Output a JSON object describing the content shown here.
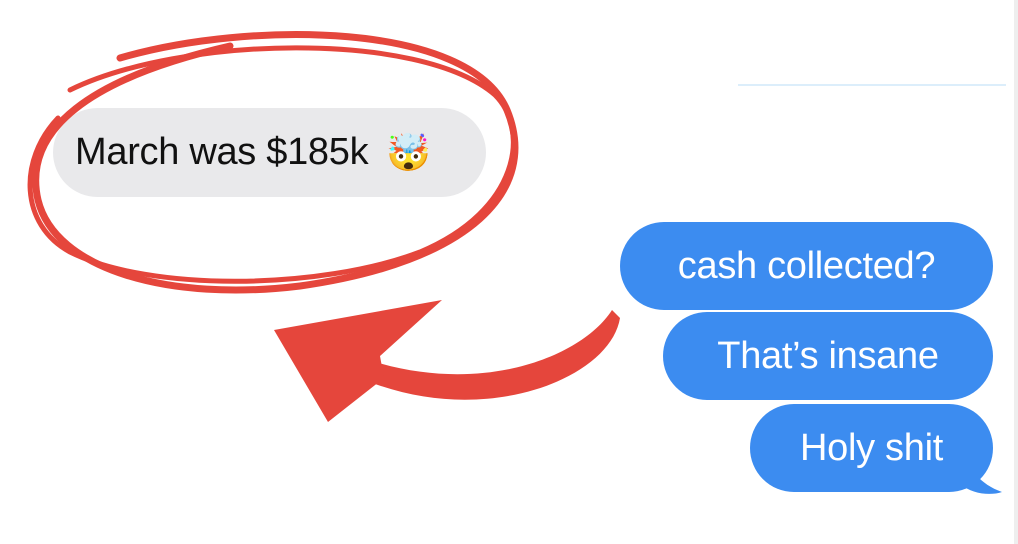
{
  "conversation": {
    "incoming": {
      "text": "March was $185k",
      "emoji": "🤯",
      "emoji_icon": "exploding-head-emoji"
    },
    "outgoing": [
      {
        "text": "cash collected?"
      },
      {
        "text": "That’s insane"
      },
      {
        "text": "Holy shit"
      }
    ]
  },
  "annotations": {
    "highlight": "red-circle",
    "pointer": "red-arrow"
  },
  "colors": {
    "incoming_bubble": "#e9e9eb",
    "outgoing_bubble": "#3c8cf0",
    "annotation_red": "#e5463c"
  }
}
